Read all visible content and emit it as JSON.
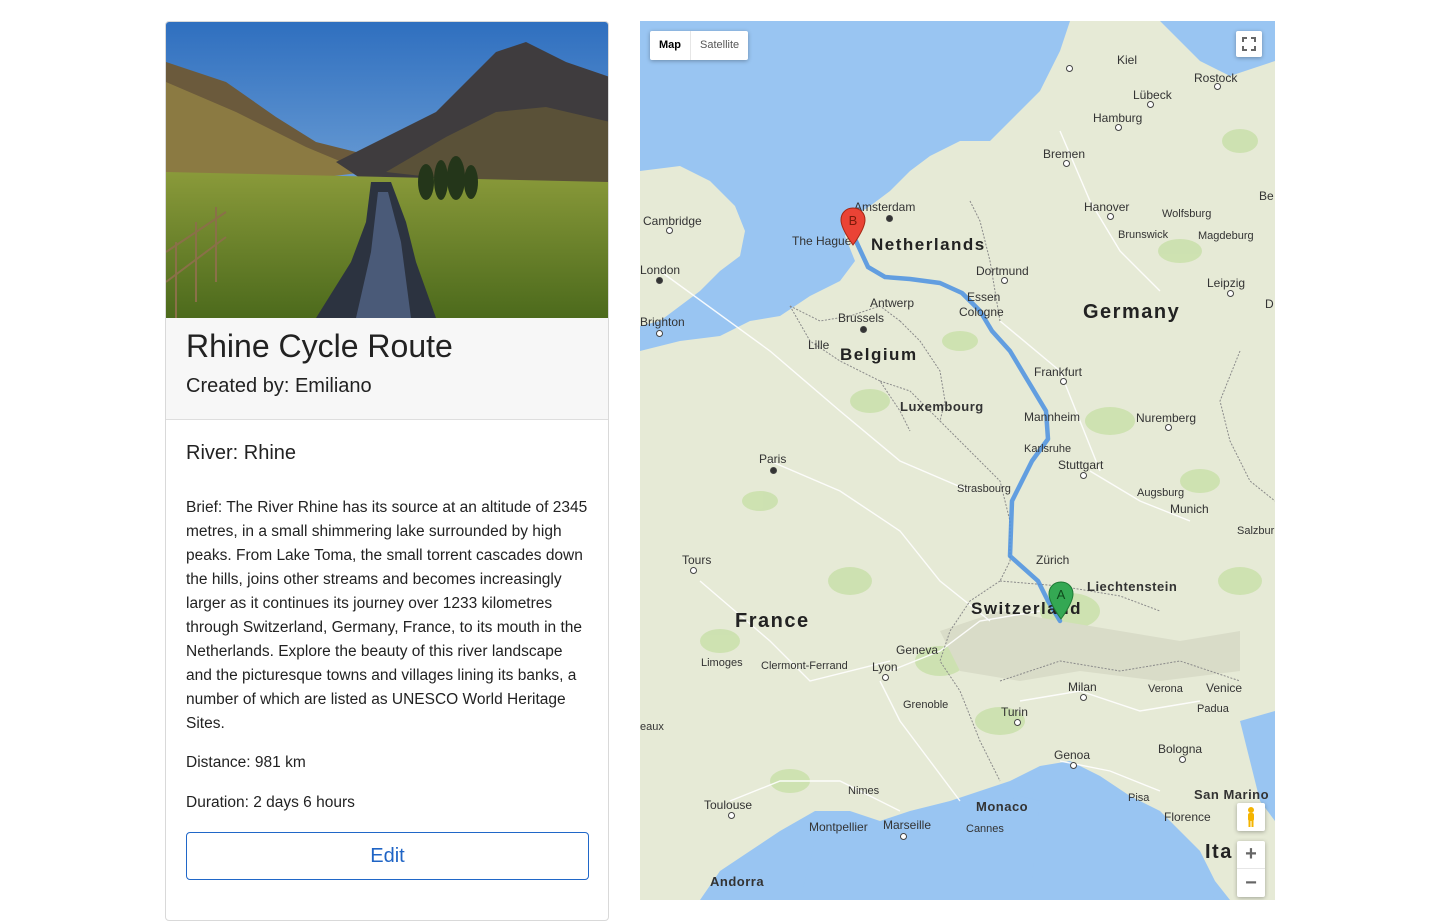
{
  "card": {
    "title": "Rhine Cycle Route",
    "created_by": "Created by: Emiliano",
    "river": "River: Rhine",
    "brief": "Brief: The River Rhine has its source at an altitude of 2345 metres, in a small shimmering lake surrounded by high peaks. From Lake Toma, the small torrent cascades down the hills, joins other streams and becomes increasingly larger as it continues its journey over 1233 kilometres through Switzerland, Germany, France, to its mouth in the Netherlands. Explore the beauty of this river landscape and the picturesque towns and villages lining its banks, a number of which are listed as UNESCO World Heritage Sites.",
    "distance": "Distance: 981 km",
    "duration": "Duration: 2 days 6 hours",
    "edit_label": "Edit"
  },
  "map": {
    "type_map": "Map",
    "type_satellite": "Satellite",
    "zoom_in": "+",
    "zoom_out": "−",
    "marker_a": "A",
    "marker_b": "B",
    "countries": {
      "netherlands": "Netherlands",
      "germany": "Germany",
      "belgium": "Belgium",
      "luxembourg": "Luxembourg",
      "france": "France",
      "switzerland": "Switzerland",
      "liechtenstein": "Liechtenstein",
      "italy": "Ita",
      "monaco": "Monaco",
      "andorra": "Andorra",
      "san_marino": "San Marino"
    },
    "cities": {
      "kiel": "Kiel",
      "rostock": "Rostock",
      "lubeck": "Lübeck",
      "hamburg": "Hamburg",
      "bremen": "Bremen",
      "be": "Be",
      "hanover": "Hanover",
      "wolfsburg": "Wolfsburg",
      "brunswick": "Brunswick",
      "magdeburg": "Magdeburg",
      "amsterdam": "Amsterdam",
      "cambridge": "Cambridge",
      "the_hague": "The Hague",
      "london": "London",
      "dortmund": "Dortmund",
      "leipzig": "Leipzig",
      "essen": "Essen",
      "antwerp": "Antwerp",
      "brighton": "Brighton",
      "cologne": "Cologne",
      "brussels": "Brussels",
      "lille": "Lille",
      "d": "D",
      "frankfurt": "Frankfurt",
      "mannheim": "Mannheim",
      "nuremberg": "Nuremberg",
      "paris": "Paris",
      "karlsruhe": "Karlsruhe",
      "stuttgart": "Stuttgart",
      "strasbourg": "Strasbourg",
      "augsburg": "Augsburg",
      "munich": "Munich",
      "salzbur": "Salzbur",
      "tours": "Tours",
      "zurich": "Zürich",
      "geneva": "Geneva",
      "limoges": "Limoges",
      "clermont": "Clermont-Ferrand",
      "lyon": "Lyon",
      "milan": "Milan",
      "verona": "Verona",
      "venice": "Venice",
      "padua": "Padua",
      "grenoble": "Grenoble",
      "turin": "Turin",
      "eaux": "eaux",
      "bologna": "Bologna",
      "genoa": "Genoa",
      "toulouse": "Toulouse",
      "nimes": "Nimes",
      "pisa": "Pisa",
      "florence": "Florence",
      "montpellier": "Montpellier",
      "marseille": "Marseille",
      "cannes": "Cannes"
    }
  }
}
